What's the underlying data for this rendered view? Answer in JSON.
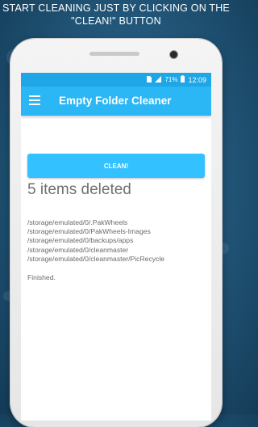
{
  "banner": {
    "line1": "START CLEANING JUST BY CLICKING ON THE",
    "line2": "\"CLEAN!\" BUTTON"
  },
  "statusbar": {
    "battery": "71%",
    "time": "12:09",
    "icons": [
      "sim-icon",
      "signal-icon",
      "battery-icon"
    ]
  },
  "toolbar": {
    "title": "Empty Folder Cleaner",
    "menu_icon": "hamburger-menu-icon"
  },
  "clean_button": {
    "label": "CLEAN!"
  },
  "result": {
    "heading": "5 items deleted",
    "deleted_paths": [
      "/storage/emulated/0/.PakWheels",
      "/storage/emulated/0/PakWheels-Images",
      "/storage/emulated/0/backups/apps",
      "/storage/emulated/0/cleanmaster",
      "/storage/emulated/0/cleanmaster/PicRecycle"
    ],
    "status": "Finished."
  },
  "colors": {
    "statusbar": "#1ea6e6",
    "toolbar": "#2bb6f5",
    "button": "#33c1ff"
  }
}
